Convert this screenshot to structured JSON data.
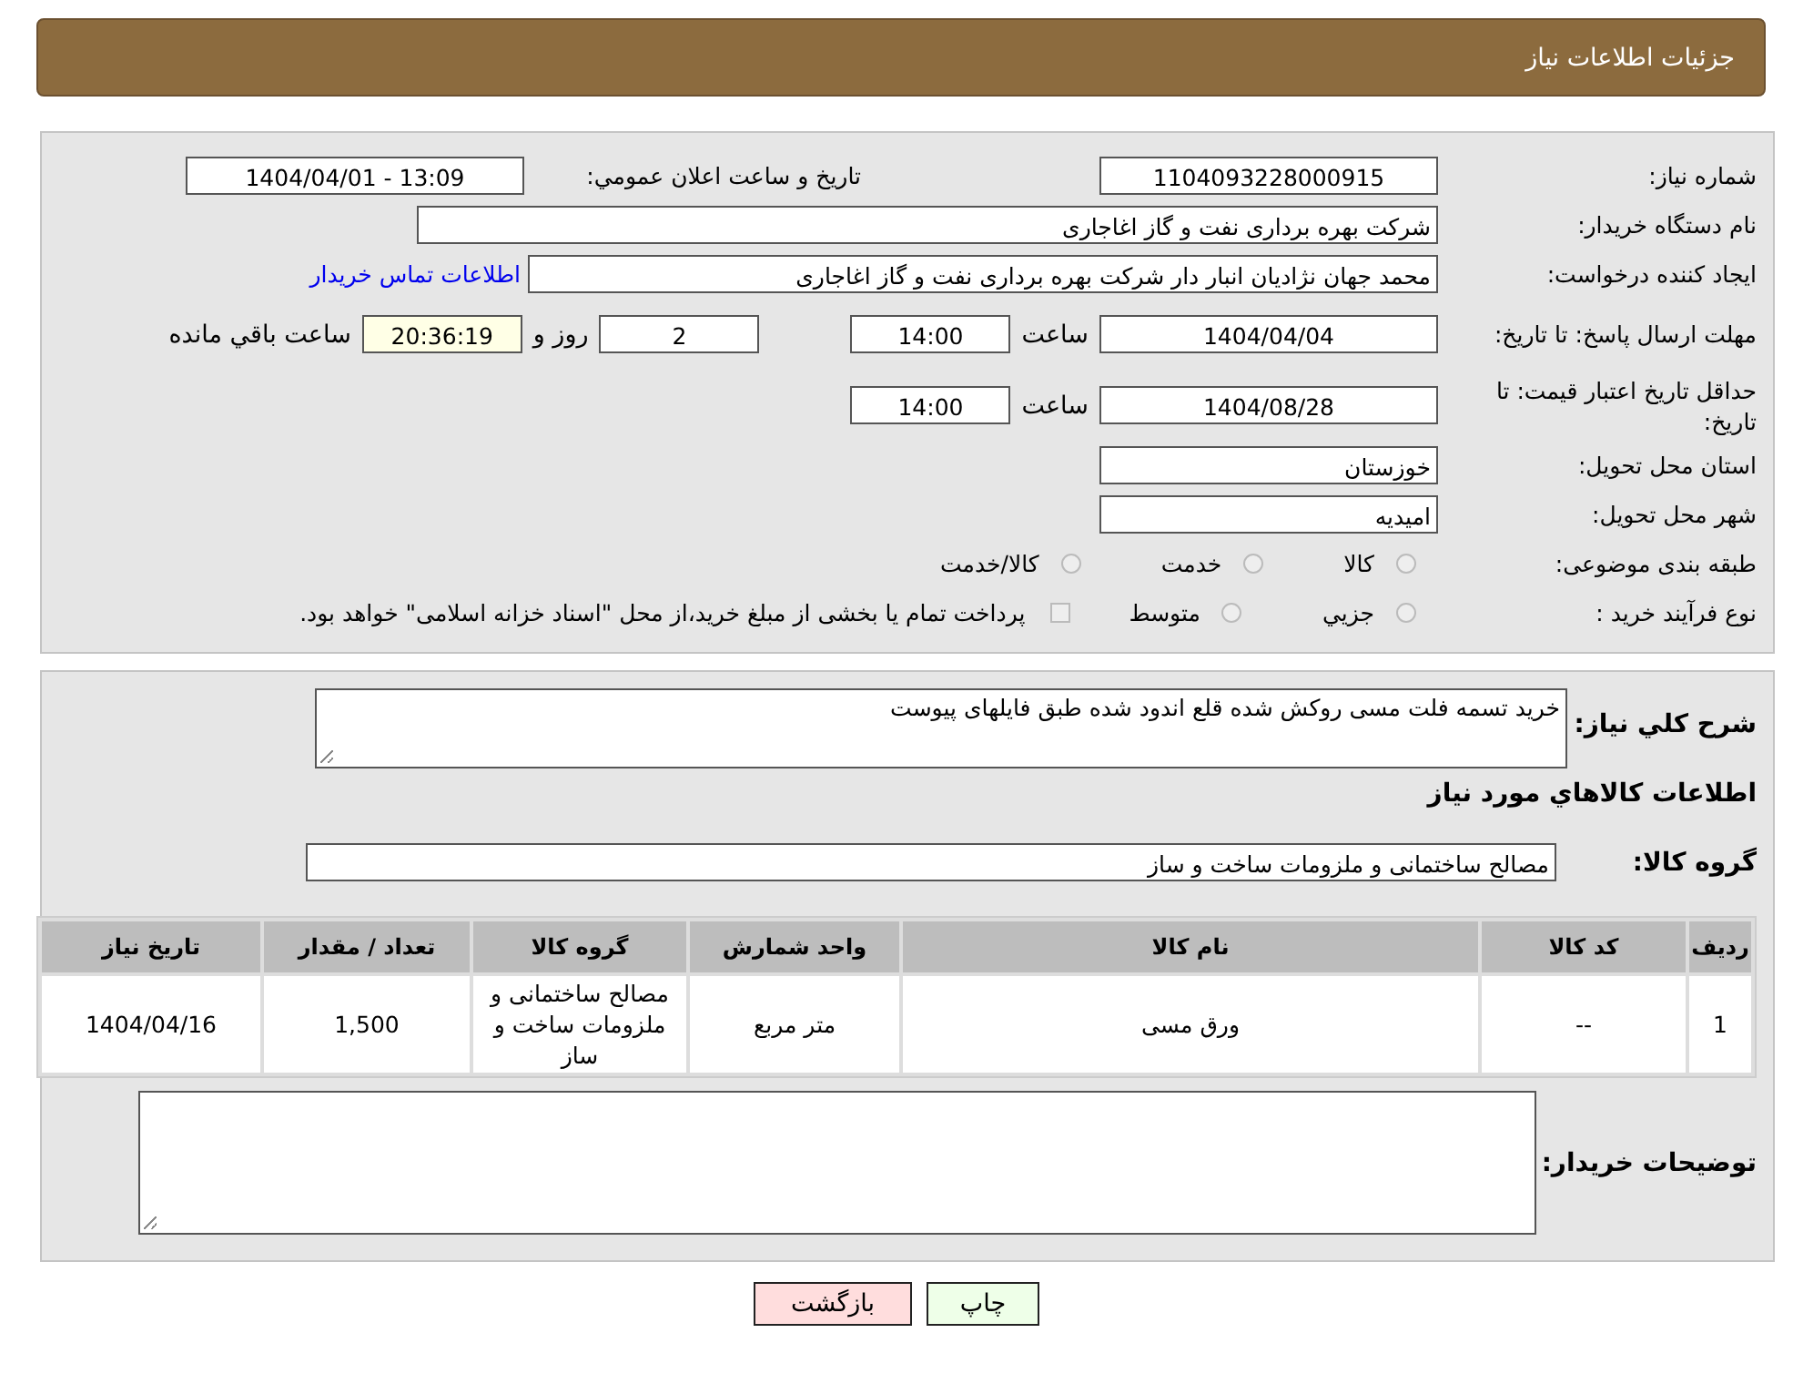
{
  "header": {
    "title": "جزئیات اطلاعات نیاز"
  },
  "need_number": {
    "label": "شماره نیاز:",
    "value": "1104093228000915"
  },
  "announce_datetime": {
    "label": "تاریخ و ساعت اعلان عمومي:",
    "value": "1404/04/01 - 13:09"
  },
  "buyer_org": {
    "label": "نام دستگاه خریدار:",
    "value": "شرکت بهره برداری نفت و گاز اغاجاری"
  },
  "requester": {
    "label": "ایجاد کننده درخواست:",
    "value": "محمد جهان نژادیان انبار دار شرکت بهره برداری نفت و گاز اغاجاری",
    "link": "اطلاعات تماس خریدار"
  },
  "reply_deadline": {
    "label": "مهلت ارسال پاسخ: تا تاریخ:",
    "date": "1404/04/04",
    "time_label": "ساعت",
    "time": "14:00",
    "days": "2",
    "days_label": "روز و",
    "remaining": "20:36:19",
    "remaining_label": "ساعت باقي مانده"
  },
  "price_validity": {
    "label": "حداقل تاریخ اعتبار قیمت: تا تاریخ:",
    "date": "1404/08/28",
    "time_label": "ساعت",
    "time": "14:00"
  },
  "province": {
    "label": "استان محل تحویل:",
    "value": "خوزستان"
  },
  "city": {
    "label": "شهر محل تحویل:",
    "value": "امیدیه"
  },
  "subject_category": {
    "label": "طبقه بندی موضوعی:",
    "options": [
      {
        "label": "کالا",
        "selected": false
      },
      {
        "label": "خدمت",
        "selected": false
      },
      {
        "label": "کالا/خدمت",
        "selected": false
      }
    ]
  },
  "purchase_type": {
    "label": "نوع فرآیند خرید :",
    "options": [
      {
        "label": "جزيي",
        "selected": false
      },
      {
        "label": "متوسط",
        "selected": false
      }
    ],
    "payment_note": {
      "label": "پرداخت تمام یا بخشی از مبلغ خرید،از محل \"اسناد خزانه اسلامی\" خواهد بود.",
      "checked": false
    }
  },
  "description": {
    "label": "شرح کلي نیاز:",
    "value": "خرید تسمه فلت مسی روکش شده قلع اندود شده  طبق فایلهای پیوست"
  },
  "goods_heading": "اطلاعات کالاهاي مورد نیاز",
  "goods_group": {
    "label": "گروه کالا:",
    "value": "مصالح ساختمانی و ملزومات ساخت و ساز"
  },
  "table": {
    "columns": [
      "ردیف",
      "کد کالا",
      "نام کالا",
      "واحد شمارش",
      "گروه کالا",
      "تعداد / مقدار",
      "تاریخ نیاز"
    ],
    "rows": [
      [
        "1",
        "--",
        "ورق مسی",
        "متر مربع",
        "مصالح ساختمانی و ملزومات ساخت و ساز",
        "1,500",
        "1404/04/16"
      ]
    ]
  },
  "buyer_notes": {
    "label": "توضیحات خریدار:"
  },
  "buttons": [
    {
      "label": "چاپ",
      "kind": "print"
    },
    {
      "label": "بازگشت",
      "kind": "back"
    }
  ]
}
